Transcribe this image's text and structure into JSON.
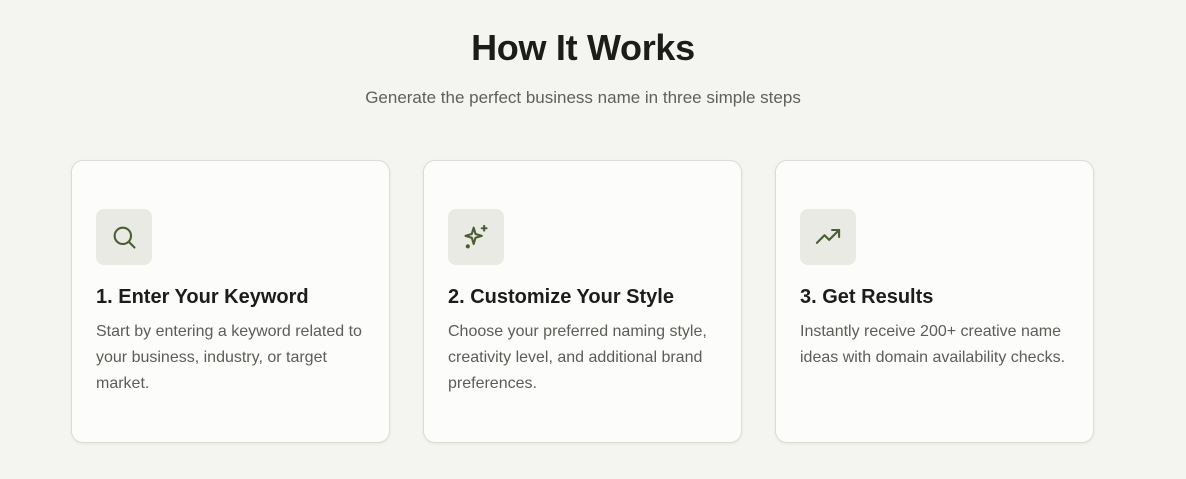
{
  "section": {
    "title": "How It Works",
    "subtitle": "Generate the perfect business name in three simple steps"
  },
  "steps": [
    {
      "icon": "search-icon",
      "title": "1. Enter Your Keyword",
      "description": "Start by entering a keyword related to your business, industry, or target market."
    },
    {
      "icon": "sparkles-icon",
      "title": "2. Customize Your Style",
      "description": "Choose your preferred naming style, creativity level, and additional brand preferences."
    },
    {
      "icon": "trending-up-icon",
      "title": "3. Get Results",
      "description": "Instantly receive 200+ creative name ideas with domain availability checks."
    }
  ],
  "colors": {
    "background": "#f4f4f0",
    "card": "#fcfcfa",
    "icon_bg": "#e8eae3",
    "icon_accent": "#4a5e33",
    "heading": "#1c1c1a",
    "body_text": "#5c5c58"
  }
}
